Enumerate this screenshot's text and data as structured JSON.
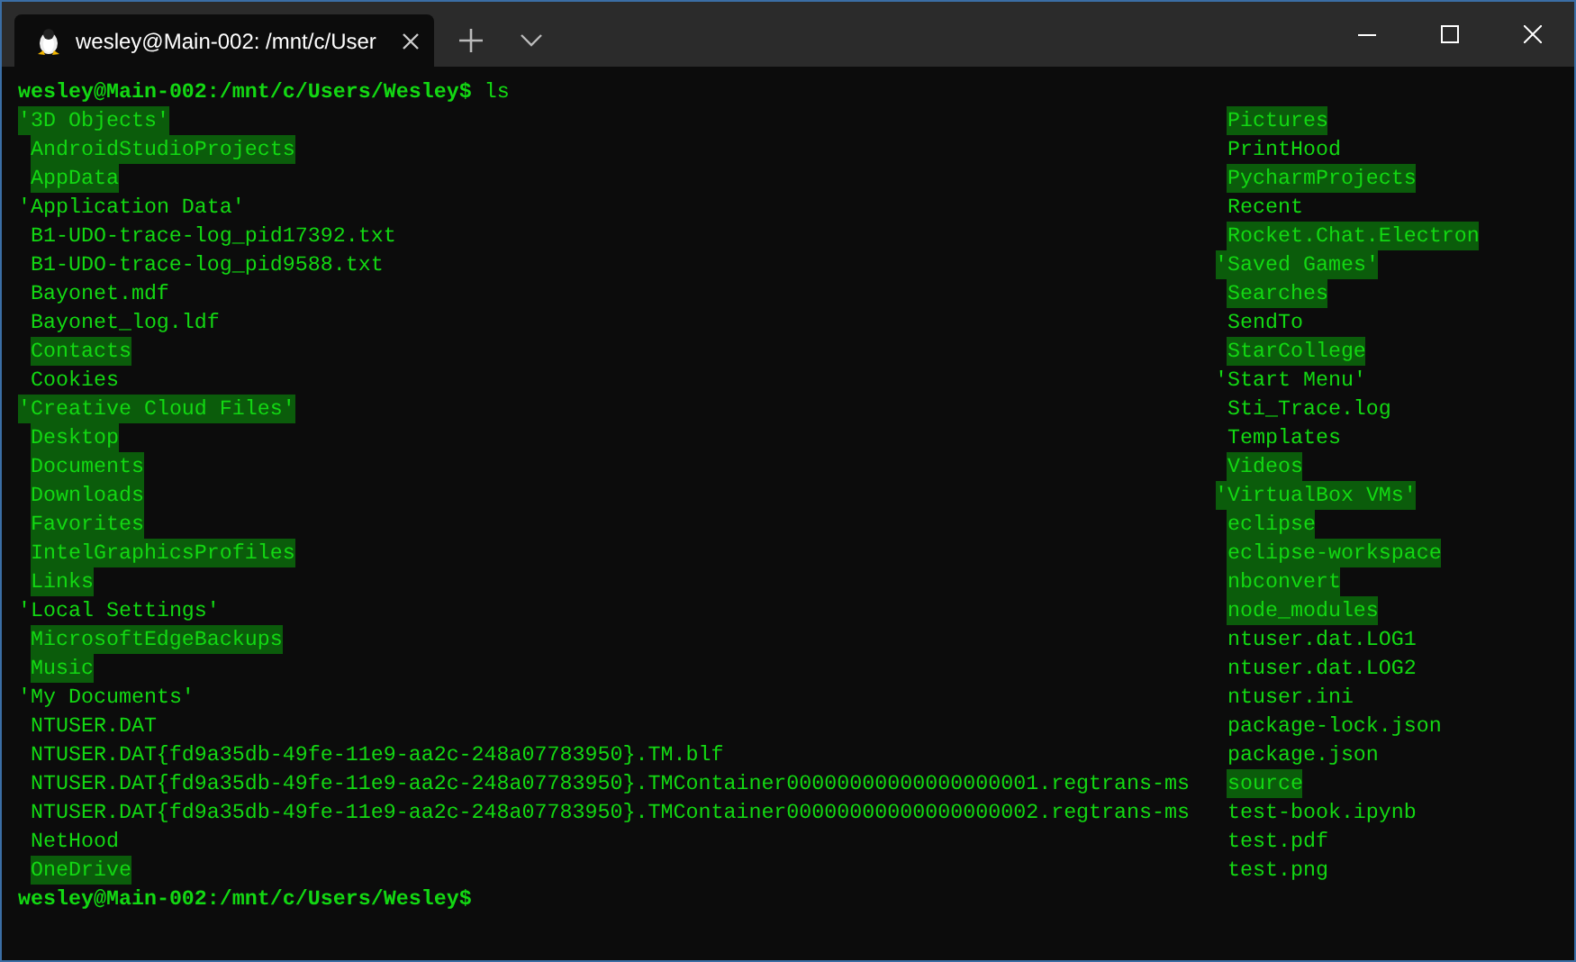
{
  "window": {
    "tab": {
      "title": "wesley@Main-002: /mnt/c/User",
      "selected": true
    }
  },
  "terminal": {
    "command_line": {
      "prompt": "wesley@Main-002:/mnt/c/Users/Wesley$",
      "command": "ls"
    },
    "listing": {
      "columns": [
        [
          {
            "name": "'3D Objects'",
            "kind": "quoted",
            "highlighted": true
          },
          {
            "name": "AndroidStudioProjects",
            "kind": "plain",
            "highlighted": true
          },
          {
            "name": "AppData",
            "kind": "plain",
            "highlighted": true
          },
          {
            "name": "'Application Data'",
            "kind": "quoted",
            "highlighted": false
          },
          {
            "name": "B1-UDO-trace-log_pid17392.txt",
            "kind": "plain",
            "highlighted": false
          },
          {
            "name": "B1-UDO-trace-log_pid9588.txt",
            "kind": "plain",
            "highlighted": false
          },
          {
            "name": "Bayonet.mdf",
            "kind": "plain",
            "highlighted": false
          },
          {
            "name": "Bayonet_log.ldf",
            "kind": "plain",
            "highlighted": false
          },
          {
            "name": "Contacts",
            "kind": "plain",
            "highlighted": true
          },
          {
            "name": "Cookies",
            "kind": "plain",
            "highlighted": false
          },
          {
            "name": "'Creative Cloud Files'",
            "kind": "quoted",
            "highlighted": true
          },
          {
            "name": "Desktop",
            "kind": "plain",
            "highlighted": true
          },
          {
            "name": "Documents",
            "kind": "plain",
            "highlighted": true
          },
          {
            "name": "Downloads",
            "kind": "plain",
            "highlighted": true
          },
          {
            "name": "Favorites",
            "kind": "plain",
            "highlighted": true
          },
          {
            "name": "IntelGraphicsProfiles",
            "kind": "plain",
            "highlighted": true
          },
          {
            "name": "Links",
            "kind": "plain",
            "highlighted": true
          },
          {
            "name": "'Local Settings'",
            "kind": "quoted",
            "highlighted": false
          },
          {
            "name": "MicrosoftEdgeBackups",
            "kind": "plain",
            "highlighted": true
          },
          {
            "name": "Music",
            "kind": "plain",
            "highlighted": true
          },
          {
            "name": "'My Documents'",
            "kind": "quoted",
            "highlighted": false
          },
          {
            "name": "NTUSER.DAT",
            "kind": "plain",
            "highlighted": false
          },
          {
            "name": "NTUSER.DAT{fd9a35db-49fe-11e9-aa2c-248a07783950}.TM.blf",
            "kind": "plain",
            "highlighted": false
          },
          {
            "name": "NTUSER.DAT{fd9a35db-49fe-11e9-aa2c-248a07783950}.TMContainer00000000000000000001.regtrans-ms",
            "kind": "plain",
            "highlighted": false
          },
          {
            "name": "NTUSER.DAT{fd9a35db-49fe-11e9-aa2c-248a07783950}.TMContainer00000000000000000002.regtrans-ms",
            "kind": "plain",
            "highlighted": false
          },
          {
            "name": "NetHood",
            "kind": "plain",
            "highlighted": false
          },
          {
            "name": "OneDrive",
            "kind": "plain",
            "highlighted": true
          }
        ],
        [
          {
            "name": "Pictures",
            "kind": "plain",
            "highlighted": true
          },
          {
            "name": "PrintHood",
            "kind": "plain",
            "highlighted": false
          },
          {
            "name": "PycharmProjects",
            "kind": "plain",
            "highlighted": true
          },
          {
            "name": "Recent",
            "kind": "plain",
            "highlighted": false
          },
          {
            "name": "Rocket.Chat.Electron",
            "kind": "plain",
            "highlighted": true
          },
          {
            "name": "'Saved Games'",
            "kind": "quoted",
            "highlighted": true
          },
          {
            "name": "Searches",
            "kind": "plain",
            "highlighted": true
          },
          {
            "name": "SendTo",
            "kind": "plain",
            "highlighted": false
          },
          {
            "name": "StarCollege",
            "kind": "plain",
            "highlighted": true
          },
          {
            "name": "'Start Menu'",
            "kind": "quoted",
            "highlighted": false
          },
          {
            "name": "Sti_Trace.log",
            "kind": "plain",
            "highlighted": false
          },
          {
            "name": "Templates",
            "kind": "plain",
            "highlighted": false
          },
          {
            "name": "Videos",
            "kind": "plain",
            "highlighted": true
          },
          {
            "name": "'VirtualBox VMs'",
            "kind": "quoted",
            "highlighted": true
          },
          {
            "name": "eclipse",
            "kind": "plain",
            "highlighted": true
          },
          {
            "name": "eclipse-workspace",
            "kind": "plain",
            "highlighted": true
          },
          {
            "name": "nbconvert",
            "kind": "plain",
            "highlighted": true
          },
          {
            "name": "node_modules",
            "kind": "plain",
            "highlighted": true
          },
          {
            "name": "ntuser.dat.LOG1",
            "kind": "plain",
            "highlighted": false
          },
          {
            "name": "ntuser.dat.LOG2",
            "kind": "plain",
            "highlighted": false
          },
          {
            "name": "ntuser.ini",
            "kind": "plain",
            "highlighted": false
          },
          {
            "name": "package-lock.json",
            "kind": "plain",
            "highlighted": false
          },
          {
            "name": "package.json",
            "kind": "plain",
            "highlighted": false
          },
          {
            "name": "source",
            "kind": "plain",
            "highlighted": true
          },
          {
            "name": "test-book.ipynb",
            "kind": "plain",
            "highlighted": false
          },
          {
            "name": "test.pdf",
            "kind": "plain",
            "highlighted": false
          },
          {
            "name": "test.png",
            "kind": "plain",
            "highlighted": false
          }
        ]
      ]
    },
    "prompt": "wesley@Main-002:/mnt/c/Users/Wesley$"
  }
}
